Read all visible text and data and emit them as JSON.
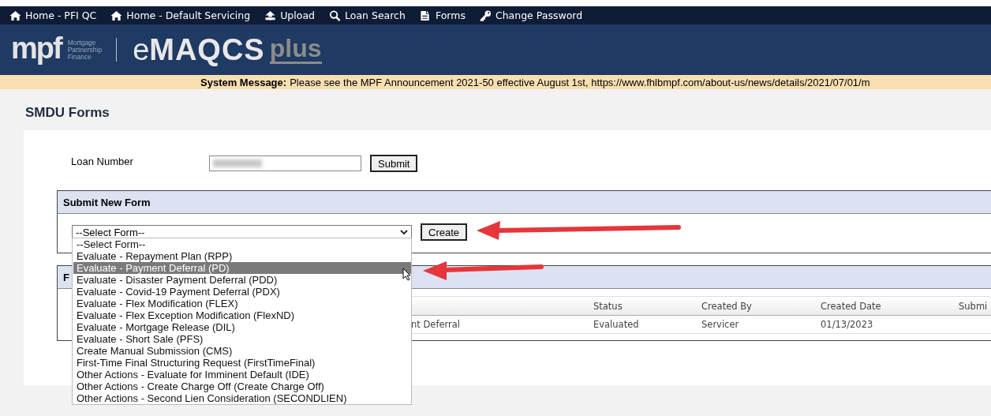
{
  "nav": [
    {
      "kind": "home",
      "label": "Home - PFI QC"
    },
    {
      "kind": "home",
      "label": "Home - Default Servicing"
    },
    {
      "kind": "upload",
      "label": "Upload"
    },
    {
      "kind": "search",
      "label": "Loan Search"
    },
    {
      "kind": "forms",
      "label": "Forms"
    },
    {
      "kind": "key",
      "label": "Change Password"
    }
  ],
  "logo": {
    "brand": "mpf",
    "tagline": [
      "Mortgage",
      "Partnership",
      "Finance"
    ],
    "product_prefix": "e",
    "product": "MAQCS",
    "suffix": "plus"
  },
  "system_message": {
    "label": "System Message:",
    "text": "Please see the MPF Announcement 2021-50 effective August 1st, https://www.fhlbmpf.com/about-us/news/details/2021/07/01/m"
  },
  "page_title": "SMDU Forms",
  "loan_search": {
    "label": "Loan Number",
    "button": "Submit"
  },
  "new_form_panel": {
    "title": "Submit New Form",
    "select": {
      "value": "--Select Form--",
      "expanded": true
    },
    "button": "Create",
    "options": [
      {
        "label": "--Select Form--",
        "selected": false
      },
      {
        "label": "Evaluate - Repayment Plan (RPP)",
        "selected": false
      },
      {
        "label": "Evaluate - Payment Deferral (PD)",
        "selected": true
      },
      {
        "label": "Evaluate - Disaster Payment Deferral (PDD)",
        "selected": false
      },
      {
        "label": "Evaluate - Covid-19 Payment Deferral (PDX)",
        "selected": false
      },
      {
        "label": "Evaluate - Flex Modification (FLEX)",
        "selected": false
      },
      {
        "label": "Evaluate - Flex Exception Modification (FlexND)",
        "selected": false
      },
      {
        "label": "Evaluate - Mortgage Release (DIL)",
        "selected": false
      },
      {
        "label": "Evaluate - Short Sale (PFS)",
        "selected": false
      },
      {
        "label": "Create Manual Submission (CMS)",
        "selected": false
      },
      {
        "label": "First-Time Final Structuring Request (FirstTimeFinal)",
        "selected": false
      },
      {
        "label": "Other Actions - Evaluate for Imminent Default (IDE)",
        "selected": false
      },
      {
        "label": "Other Actions - Create Charge Off (Create Charge Off)",
        "selected": false
      },
      {
        "label": "Other Actions - Second Lien Consideration (SECONDLIEN)",
        "selected": false
      }
    ]
  },
  "forms_panel": {
    "title": "F",
    "table": {
      "columns": [
        "",
        "Status",
        "Created By",
        "Created Date",
        "Submi"
      ],
      "rows": [
        [
          "nt Deferral",
          "Evaluated",
          "Servicer",
          "01/13/2023"
        ]
      ]
    }
  }
}
